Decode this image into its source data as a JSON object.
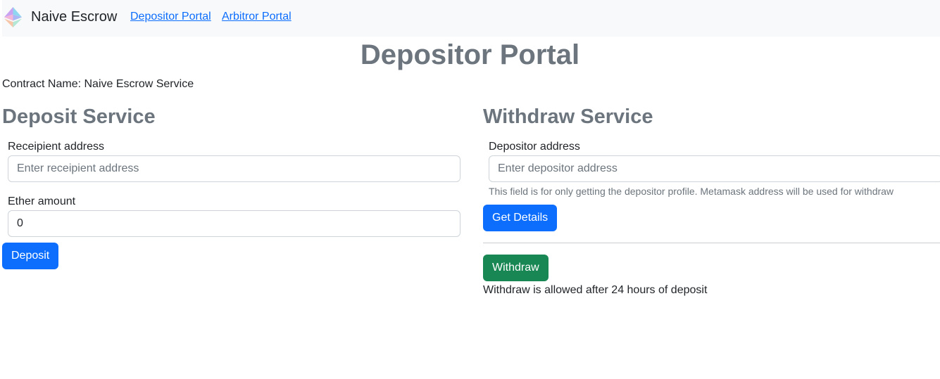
{
  "navbar": {
    "logo_icon": "ethereum-diamond-icon",
    "brand": "Naive Escrow",
    "links": [
      "Depositor Portal",
      "Arbitror Portal"
    ]
  },
  "page": {
    "title": "Depositor Portal",
    "contract_name": "Contract Name: Naive Escrow Service"
  },
  "deposit": {
    "title": "Deposit Service",
    "recipient_label": "Receipient address",
    "recipient_placeholder": "Enter receipient address",
    "amount_label": "Ether amount",
    "amount_value": "0",
    "button": "Deposit"
  },
  "withdraw": {
    "title": "Withdraw Service",
    "depositor_label": "Depositor address",
    "depositor_placeholder": "Enter depositor address",
    "help_text": "This field is for only getting the depositor profile. Metamask address will be used for withdraw",
    "details_button": "Get Details",
    "withdraw_button": "Withdraw",
    "note": "Withdraw is allowed after 24 hours of deposit"
  },
  "colors": {
    "primary": "#0d6efd",
    "success": "#198754",
    "heading": "#6c757d",
    "navbar_bg": "#f8f9fa"
  }
}
